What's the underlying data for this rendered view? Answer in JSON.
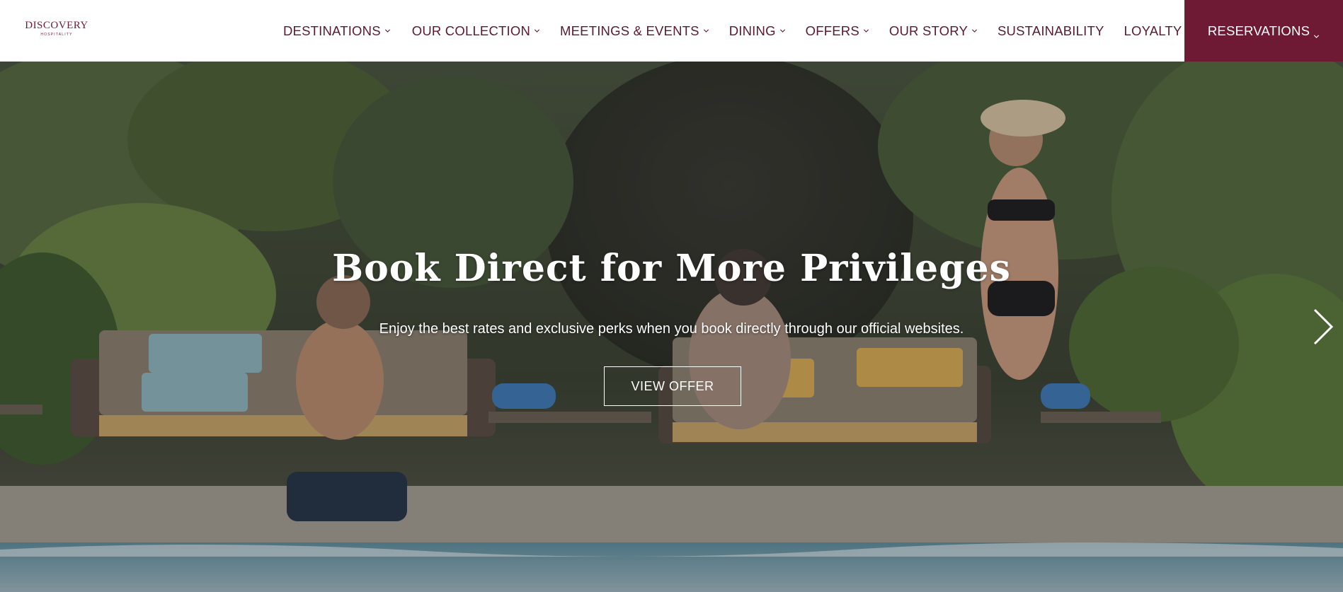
{
  "logo": {
    "name": "DISCOVERY",
    "tagline": "HOSPITALITY"
  },
  "nav": {
    "items": [
      {
        "label": "DESTINATIONS",
        "has_dropdown": true
      },
      {
        "label": "OUR COLLECTION",
        "has_dropdown": true
      },
      {
        "label": "MEETINGS & EVENTS",
        "has_dropdown": true
      },
      {
        "label": "DINING",
        "has_dropdown": true
      },
      {
        "label": "OFFERS",
        "has_dropdown": true
      },
      {
        "label": "OUR STORY",
        "has_dropdown": true
      },
      {
        "label": "SUSTAINABILITY",
        "has_dropdown": false
      },
      {
        "label": "LOYALTY",
        "has_dropdown": true
      }
    ],
    "reservations_label": "RESERVATIONS"
  },
  "hero": {
    "title": "Book Direct for More Privileges",
    "subtitle": "Enjoy the best rates and exclusive perks when you book directly through our official websites.",
    "cta_label": "VIEW OFFER",
    "next_icon": "chevron-right-icon"
  },
  "colors": {
    "brand": "#6e1a34",
    "nav_text": "#5a1a2e",
    "header_bg": "#ffffff",
    "hero_text": "#ffffff"
  }
}
